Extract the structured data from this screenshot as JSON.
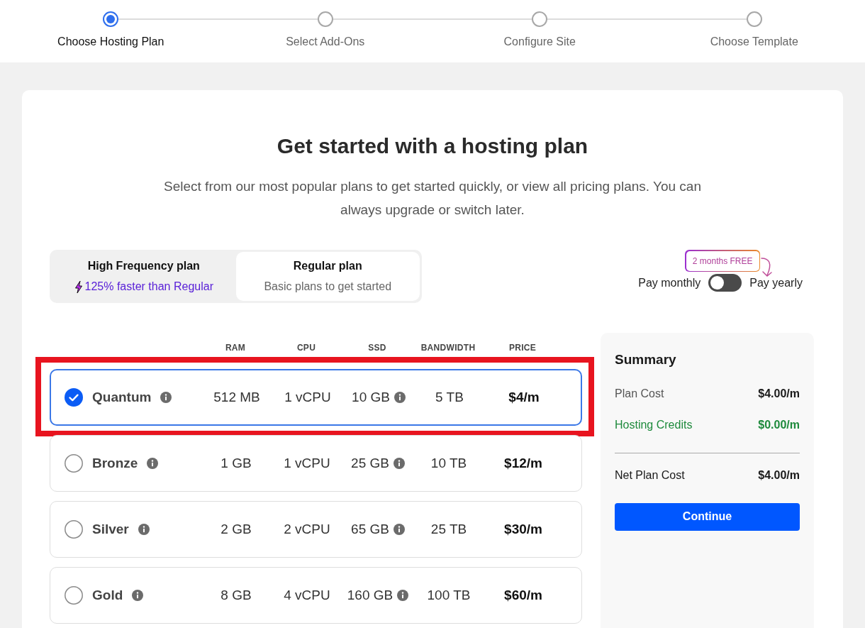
{
  "steps": [
    {
      "label": "Choose Hosting Plan",
      "selected": true
    },
    {
      "label": "Select Add-Ons",
      "selected": false
    },
    {
      "label": "Configure Site",
      "selected": false
    },
    {
      "label": "Choose Template",
      "selected": false
    }
  ],
  "title": "Get started with a hosting plan",
  "subtitle": "Select from our most popular plans to get started quickly, or view all pricing plans. You can always upgrade or switch later.",
  "plan_types": [
    {
      "title": "High Frequency plan",
      "subtitle": "125% faster than Regular",
      "kind": "fast",
      "selected": false
    },
    {
      "title": "Regular plan",
      "subtitle": "Basic plans to get started",
      "kind": "basic",
      "selected": true
    }
  ],
  "billing": {
    "badge": "2 months FREE",
    "monthly_label": "Pay monthly",
    "yearly_label": "Pay yearly",
    "yearly": false
  },
  "table": {
    "columns": [
      "RAM",
      "CPU",
      "SSD",
      "BANDWIDTH",
      "PRICE"
    ],
    "rows": [
      {
        "name": "Quantum",
        "ram": "512 MB",
        "cpu": "1 vCPU",
        "ssd": "10 GB",
        "bandwidth": "5 TB",
        "price": "$4/m",
        "selected": true,
        "highlighted": true
      },
      {
        "name": "Bronze",
        "ram": "1 GB",
        "cpu": "1 vCPU",
        "ssd": "25 GB",
        "bandwidth": "10 TB",
        "price": "$12/m",
        "selected": false,
        "highlighted": false
      },
      {
        "name": "Silver",
        "ram": "2 GB",
        "cpu": "2 vCPU",
        "ssd": "65 GB",
        "bandwidth": "25 TB",
        "price": "$30/m",
        "selected": false,
        "highlighted": false
      },
      {
        "name": "Gold",
        "ram": "8 GB",
        "cpu": "4 vCPU",
        "ssd": "160 GB",
        "bandwidth": "100 TB",
        "price": "$60/m",
        "selected": false,
        "highlighted": false
      }
    ]
  },
  "summary": {
    "title": "Summary",
    "lines": [
      {
        "label": "Plan Cost",
        "value": "$4.00/m",
        "kind": "normal"
      },
      {
        "label": "Hosting Credits",
        "value": "$0.00/m",
        "kind": "credit"
      }
    ],
    "total": {
      "label": "Net Plan Cost",
      "value": "$4.00/m"
    },
    "button": "Continue"
  }
}
